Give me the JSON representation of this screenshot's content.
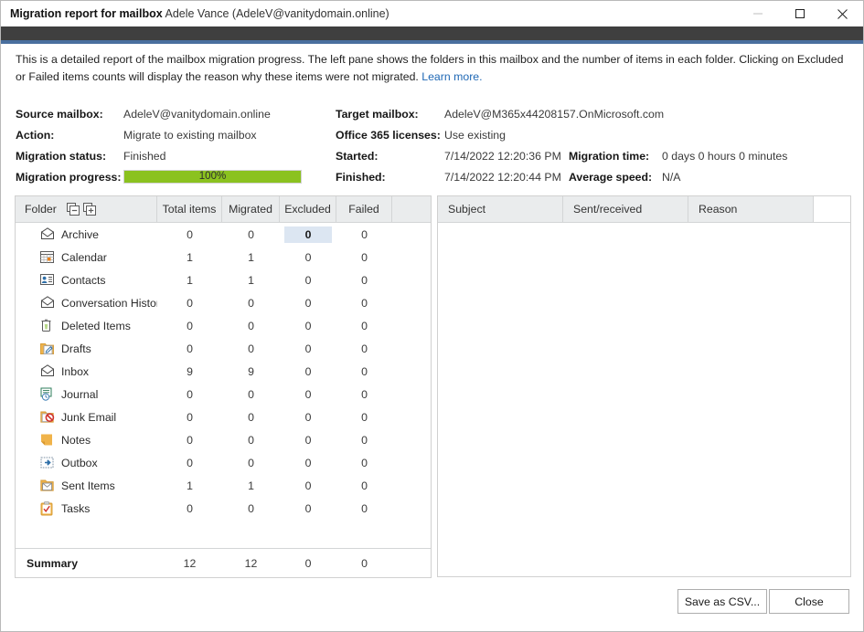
{
  "window": {
    "title_bold": "Migration report for mailbox",
    "title_rest": "Adele Vance (AdeleV@vanitydomain.online)",
    "controls": {
      "minimize": "minimize-button",
      "maximize": "maximize-button",
      "close": "close-button"
    }
  },
  "description": {
    "text": "This is a detailed report of the mailbox migration progress. The left pane shows the folders in this mailbox and the number of items in each folder. Clicking on Excluded or Failed items counts will display the reason why these items were not migrated. ",
    "link_label": "Learn more."
  },
  "meta": {
    "source_mailbox_label": "Source mailbox:",
    "source_mailbox_value": "AdeleV@vanitydomain.online",
    "action_label": "Action:",
    "action_value": "Migrate to existing mailbox",
    "migration_status_label": "Migration status:",
    "migration_status_value": "Finished",
    "migration_progress_label": "Migration progress:",
    "migration_progress_value": "100%",
    "migration_progress_percent": 100,
    "target_mailbox_label": "Target mailbox:",
    "target_mailbox_value": "AdeleV@M365x44208157.OnMicrosoft.com",
    "licenses_label": "Office 365 licenses:",
    "licenses_value": "Use existing",
    "started_label": "Started:",
    "started_value": "7/14/2022 12:20:36 PM",
    "finished_label": "Finished:",
    "finished_value": "7/14/2022 12:20:44 PM",
    "migration_time_label": "Migration time:",
    "migration_time_value": "0 days 0 hours 0 minutes",
    "average_speed_label": "Average speed:",
    "average_speed_value": "N/A"
  },
  "folder_table": {
    "headers": {
      "folder": "Folder",
      "total_items": "Total items",
      "migrated": "Migrated",
      "excluded": "Excluded",
      "failed": "Failed"
    },
    "header_icons": {
      "collapse_all": "collapse-all-icon",
      "expand_all": "expand-all-icon"
    },
    "rows": [
      {
        "icon": "envelope-icon",
        "name": "Archive",
        "total": "0",
        "migrated": "0",
        "excluded": "0",
        "failed": "0",
        "excluded_selected": true
      },
      {
        "icon": "calendar-icon",
        "name": "Calendar",
        "total": "1",
        "migrated": "1",
        "excluded": "0",
        "failed": "0",
        "excluded_selected": false
      },
      {
        "icon": "contacts-icon",
        "name": "Contacts",
        "total": "1",
        "migrated": "1",
        "excluded": "0",
        "failed": "0",
        "excluded_selected": false
      },
      {
        "icon": "envelope-icon",
        "name": "Conversation Histor",
        "total": "0",
        "migrated": "0",
        "excluded": "0",
        "failed": "0",
        "excluded_selected": false
      },
      {
        "icon": "trash-icon",
        "name": "Deleted Items",
        "total": "0",
        "migrated": "0",
        "excluded": "0",
        "failed": "0",
        "excluded_selected": false
      },
      {
        "icon": "drafts-icon",
        "name": "Drafts",
        "total": "0",
        "migrated": "0",
        "excluded": "0",
        "failed": "0",
        "excluded_selected": false
      },
      {
        "icon": "envelope-icon",
        "name": "Inbox",
        "total": "9",
        "migrated": "9",
        "excluded": "0",
        "failed": "0",
        "excluded_selected": false
      },
      {
        "icon": "journal-icon",
        "name": "Journal",
        "total": "0",
        "migrated": "0",
        "excluded": "0",
        "failed": "0",
        "excluded_selected": false
      },
      {
        "icon": "junk-icon",
        "name": "Junk Email",
        "total": "0",
        "migrated": "0",
        "excluded": "0",
        "failed": "0",
        "excluded_selected": false
      },
      {
        "icon": "notes-icon",
        "name": "Notes",
        "total": "0",
        "migrated": "0",
        "excluded": "0",
        "failed": "0",
        "excluded_selected": false
      },
      {
        "icon": "outbox-icon",
        "name": "Outbox",
        "total": "0",
        "migrated": "0",
        "excluded": "0",
        "failed": "0",
        "excluded_selected": false
      },
      {
        "icon": "sentitems-icon",
        "name": "Sent Items",
        "total": "1",
        "migrated": "1",
        "excluded": "0",
        "failed": "0",
        "excluded_selected": false
      },
      {
        "icon": "tasks-icon",
        "name": "Tasks",
        "total": "0",
        "migrated": "0",
        "excluded": "0",
        "failed": "0",
        "excluded_selected": false
      }
    ],
    "summary": {
      "label": "Summary",
      "total": "12",
      "migrated": "12",
      "excluded": "0",
      "failed": "0"
    }
  },
  "detail_table": {
    "headers": {
      "subject": "Subject",
      "sent_received": "Sent/received",
      "reason": "Reason"
    },
    "rows": []
  },
  "footer": {
    "save_csv_label": "Save as CSV...",
    "close_label": "Close"
  },
  "colors": {
    "progress_green": "#8bc21f",
    "accent_blue": "#4a6f9e",
    "link_blue": "#1f68b5",
    "selected_cell": "#dce6f2",
    "header_gray": "#eaeced",
    "dark_band": "#3f3f3f"
  }
}
